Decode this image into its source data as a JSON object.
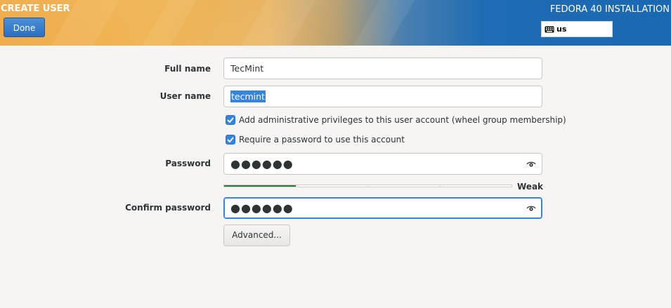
{
  "header": {
    "spoke_title": "CREATE USER",
    "done_label": "Done",
    "product_title": "FEDORA 40 INSTALLATION",
    "keyboard_layout": "us",
    "keyboard_icon": "keyboard-icon"
  },
  "form": {
    "full_name": {
      "label": "Full name",
      "value": "TecMint"
    },
    "user_name": {
      "label": "User name",
      "value": "tecmint"
    },
    "admin_checkbox": {
      "label": "Add administrative privileges to this user account (wheel group membership)",
      "checked": true
    },
    "password_checkbox": {
      "label": "Require a password to use this account",
      "checked": true
    },
    "password": {
      "label": "Password",
      "masked_value": "●●●●●●",
      "reveal_icon": "eye-icon"
    },
    "strength": {
      "label": "Weak",
      "level": 0.25,
      "segments": 4
    },
    "confirm_password": {
      "label": "Confirm password",
      "masked_value": "●●●●●●",
      "reveal_icon": "eye-icon"
    },
    "advanced_label": "Advanced..."
  },
  "colors": {
    "accent": "#3584e4",
    "strength_fill": "#26823b",
    "header_orange": "#efa53c",
    "header_blue": "#1a68b2"
  }
}
